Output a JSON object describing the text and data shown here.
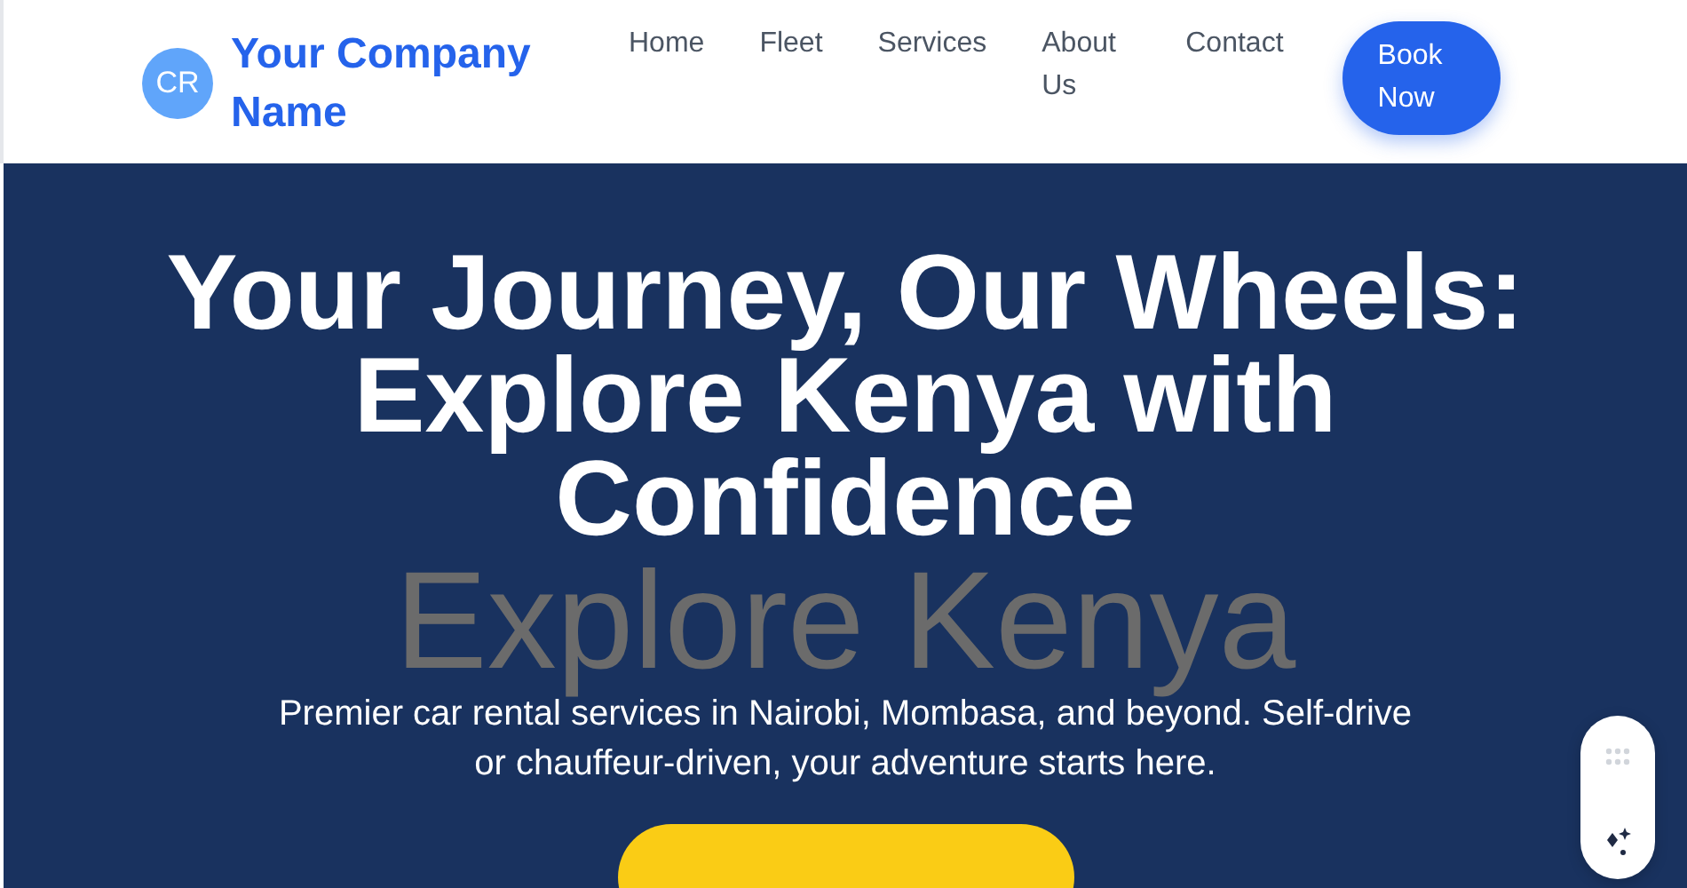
{
  "header": {
    "logo": "CR",
    "company_name": "Your Company Name",
    "nav": [
      {
        "label": "Home"
      },
      {
        "label": "Fleet"
      },
      {
        "label": "Services"
      },
      {
        "label": "About Us"
      },
      {
        "label": "Contact"
      }
    ],
    "cta": "Book Now"
  },
  "hero": {
    "headline": "Your Journey, Our Wheels: Explore Kenya with Confidence",
    "background_text": "Explore Kenya",
    "subtitle": "Premier car rental services in Nairobi, Mombasa, and beyond. Self-drive or chauffeur-driven, your adventure starts here."
  }
}
